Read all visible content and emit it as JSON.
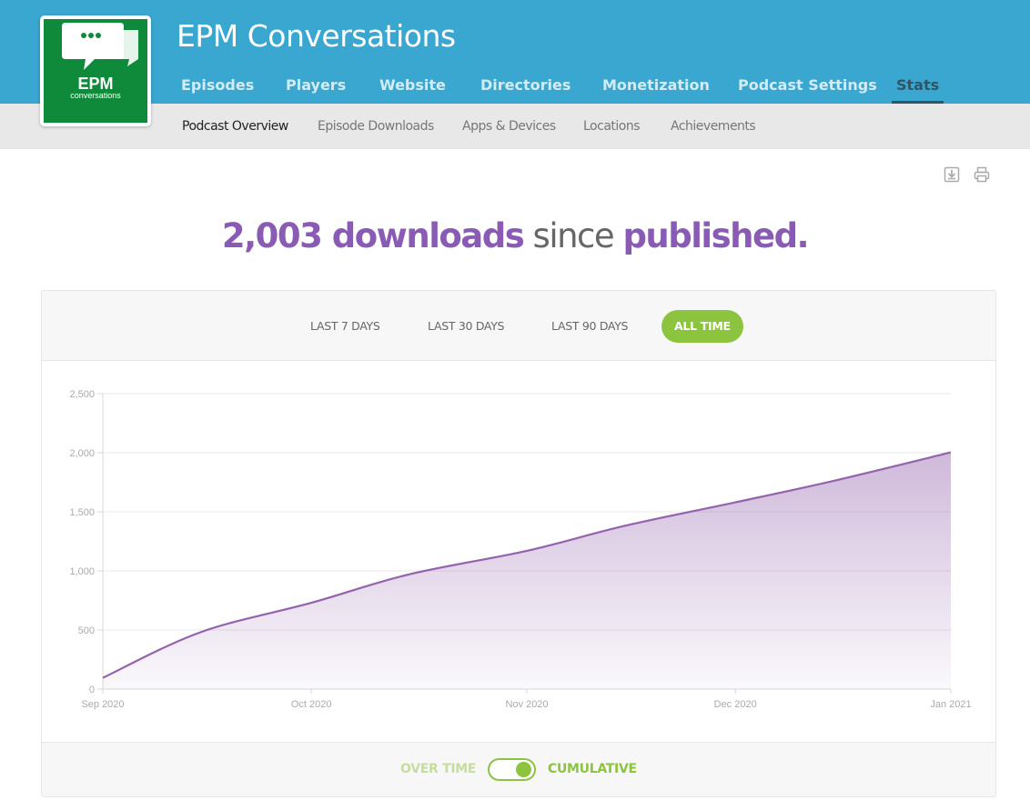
{
  "podcast": {
    "title": "EPM Conversations",
    "logo_text": "EPM",
    "logo_subtext": "conversations"
  },
  "main_nav": [
    {
      "label": "Episodes",
      "active": false
    },
    {
      "label": "Players",
      "active": false
    },
    {
      "label": "Website",
      "active": false
    },
    {
      "label": "Directories",
      "active": false
    },
    {
      "label": "Monetization",
      "active": false
    },
    {
      "label": "Podcast Settings",
      "active": false
    },
    {
      "label": "Stats",
      "active": true
    }
  ],
  "sub_nav": [
    {
      "label": "Podcast Overview",
      "active": true
    },
    {
      "label": "Episode Downloads",
      "active": false
    },
    {
      "label": "Apps & Devices",
      "active": false
    },
    {
      "label": "Locations",
      "active": false
    },
    {
      "label": "Achievements",
      "active": false
    }
  ],
  "toolbar": {
    "download_icon": "download-icon",
    "print_icon": "print-icon"
  },
  "headline": {
    "count": "2,003 downloads",
    "middle": "since",
    "end": "published."
  },
  "time_ranges": [
    {
      "label": "LAST 7 DAYS",
      "active": false
    },
    {
      "label": "LAST 30 DAYS",
      "active": false
    },
    {
      "label": "LAST 90 DAYS",
      "active": false
    },
    {
      "label": "ALL TIME",
      "active": true
    }
  ],
  "toggle": {
    "off_label": "OVER TIME",
    "on_label": "CUMULATIVE",
    "state": "cumulative"
  },
  "colors": {
    "header_blue": "#3aa7d0",
    "accent_purple": "#8a5bb5",
    "accent_green": "#8cc43f",
    "line_purple": "#9463ad"
  },
  "chart_data": {
    "type": "area",
    "title": "",
    "xlabel": "",
    "ylabel": "",
    "ylim": [
      0,
      2500
    ],
    "yticks": [
      0,
      500,
      1000,
      1500,
      2000,
      2500
    ],
    "ytick_labels": [
      "0",
      "500",
      "1,000",
      "1,500",
      "2,000",
      "2,500"
    ],
    "x_ticks": [
      "2020-09-01",
      "2020-10-01",
      "2020-11-01",
      "2020-12-01",
      "2021-01-01"
    ],
    "x_tick_labels": [
      "Sep 2020",
      "Oct 2020",
      "Nov 2020",
      "Dec 2020",
      "Jan 2021"
    ],
    "xlim": [
      "2020-09-01",
      "2021-01-01"
    ],
    "grid": true,
    "legend": "none",
    "series": [
      {
        "x": [
          "2020-09-01",
          "2020-09-15",
          "2020-10-01",
          "2020-10-15",
          "2020-11-01",
          "2020-11-15",
          "2020-12-01",
          "2020-12-15",
          "2021-01-01"
        ],
        "y": [
          95,
          480,
          730,
          970,
          1170,
          1380,
          1580,
          1760,
          2003
        ]
      }
    ]
  }
}
